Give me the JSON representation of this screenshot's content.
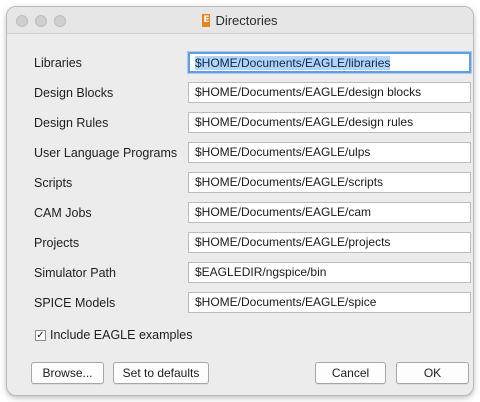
{
  "window": {
    "title": "Directories",
    "app_icon_letter": "E",
    "app_icon_color": "#e8841a"
  },
  "rows": [
    {
      "label": "Libraries",
      "value_selected": "$HOME/Documents/EAGLE/libraries",
      "value": "$HOME/Documents/EAGLE/libraries"
    },
    {
      "label": "Design Blocks",
      "value": "$HOME/Documents/EAGLE/design blocks"
    },
    {
      "label": "Design Rules",
      "value": "$HOME/Documents/EAGLE/design rules"
    },
    {
      "label": "User Language Programs",
      "value": "$HOME/Documents/EAGLE/ulps"
    },
    {
      "label": "Scripts",
      "value": "$HOME/Documents/EAGLE/scripts"
    },
    {
      "label": "CAM Jobs",
      "value": "$HOME/Documents/EAGLE/cam"
    },
    {
      "label": "Projects",
      "value": "$HOME/Documents/EAGLE/projects"
    },
    {
      "label": "Simulator Path",
      "value": "$EAGLEDIR/ngspice/bin"
    },
    {
      "label": "SPICE Models",
      "value": "$HOME/Documents/EAGLE/spice"
    }
  ],
  "checkbox": {
    "label": "Include EAGLE examples",
    "checked": true,
    "mark": "✓"
  },
  "buttons": {
    "browse": "Browse...",
    "set_defaults": "Set to defaults",
    "cancel": "Cancel",
    "ok": "OK"
  },
  "colors": {
    "focus_ring": "#5f9ee0",
    "selection": "#b3d3f9"
  }
}
